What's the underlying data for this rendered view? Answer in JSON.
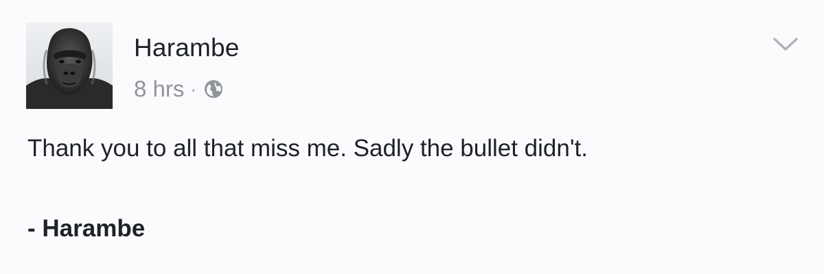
{
  "post": {
    "author_name": "Harambe",
    "timestamp": "8 hrs",
    "separator": "·",
    "privacy_icon": "globe-icon",
    "menu_icon": "chevron-down-icon",
    "avatar_subject": "gorilla-profile-photo",
    "text": "Thank you to all that miss me. Sadly the bullet didn't.",
    "signature": "- Harambe"
  },
  "colors": {
    "background": "#fbfbfd",
    "text_primary": "#1d2129",
    "text_secondary": "#90949c",
    "icon_gray": "#b0b3b8"
  }
}
